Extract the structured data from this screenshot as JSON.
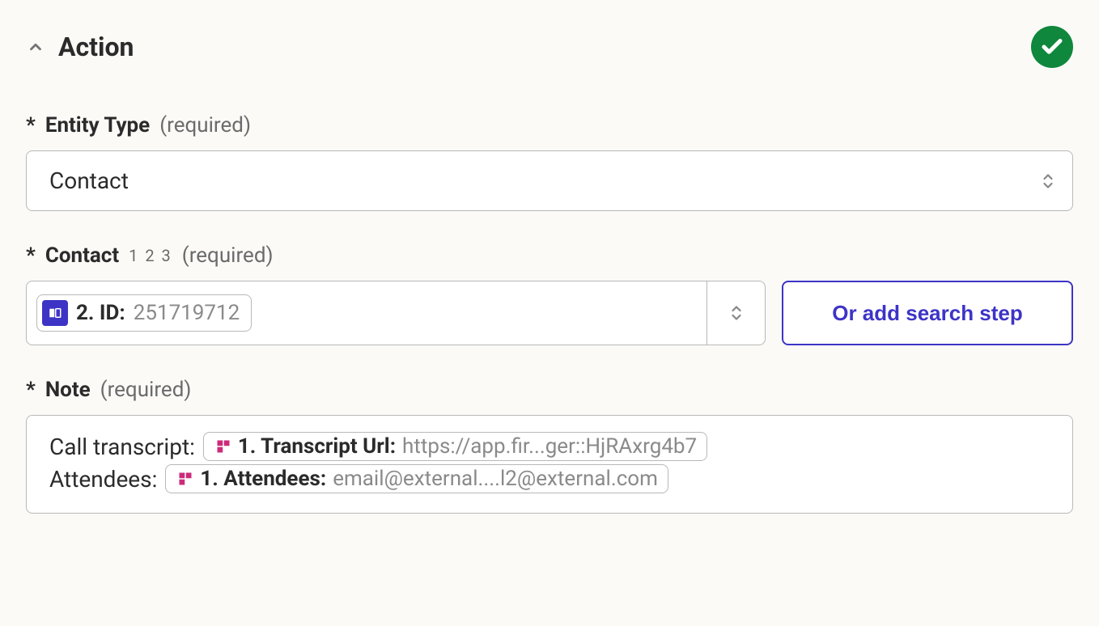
{
  "header": {
    "title": "Action",
    "status": "success"
  },
  "fields": {
    "entityType": {
      "asterisk": "*",
      "label": "Entity Type",
      "required": "(required)",
      "value": "Contact"
    },
    "contact": {
      "asterisk": "*",
      "label": "Contact",
      "hint": "1 2 3",
      "required": "(required)",
      "pill": {
        "icon": "phone-card-icon",
        "label": "2. ID:",
        "value": "251719712"
      },
      "addSearchButton": "Or add search step"
    },
    "note": {
      "asterisk": "*",
      "label": "Note",
      "required": "(required)",
      "lines": [
        {
          "prefix": "Call transcript:",
          "pillLabel": "1. Transcript Url:",
          "pillValue": "https://app.fir...ger::HjRAxrg4b7"
        },
        {
          "prefix": "Attendees:",
          "pillLabel": "1. Attendees:",
          "pillValue": "email@external....l2@external.com"
        }
      ]
    }
  }
}
